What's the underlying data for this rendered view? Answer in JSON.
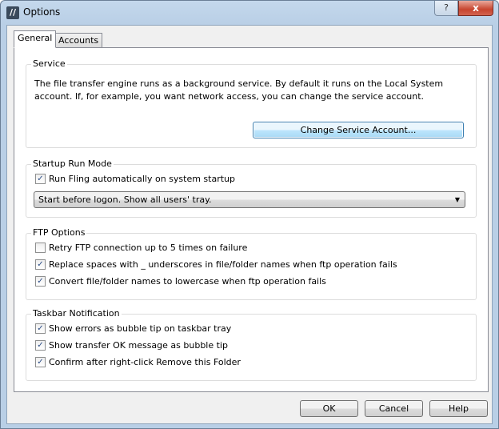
{
  "window": {
    "title": "Options",
    "help_label": "?",
    "close_label": "x",
    "app_icon": "//"
  },
  "tabs": [
    {
      "label": "General",
      "active": true
    },
    {
      "label": "Accounts",
      "active": false
    }
  ],
  "service": {
    "label": "Service",
    "text": "The file transfer engine runs as a background service. By default it runs on the Local System account. If, for example, you want network access, you can change the service account.",
    "button": "Change Service Account..."
  },
  "startup": {
    "label": "Startup Run Mode",
    "checkbox": {
      "label": "Run Fling automatically on system startup",
      "checked": true
    },
    "dropdown_value": "Start before logon. Show all users' tray.",
    "arrow": "▼"
  },
  "ftp": {
    "label": "FTP Options",
    "checkboxes": [
      {
        "label": "Retry FTP connection up to 5 times on failure",
        "checked": false,
        "mark": ""
      },
      {
        "label": "Replace spaces with _ underscores in file/folder names when ftp operation fails",
        "checked": true,
        "mark": "✓"
      },
      {
        "label": "Convert file/folder names to lowercase when ftp operation fails",
        "checked": true,
        "mark": "✓"
      }
    ]
  },
  "taskbar": {
    "label": "Taskbar Notification",
    "checkboxes": [
      {
        "label": "Show errors as bubble tip on taskbar tray",
        "checked": true,
        "mark": "✓"
      },
      {
        "label": "Show transfer OK message as bubble tip",
        "checked": true,
        "mark": "✓"
      },
      {
        "label": "Confirm after right-click Remove this Folder",
        "checked": true,
        "mark": "✓"
      }
    ]
  },
  "check_mark": "✓",
  "buttons": {
    "ok": "OK",
    "cancel": "Cancel",
    "help": "Help"
  }
}
